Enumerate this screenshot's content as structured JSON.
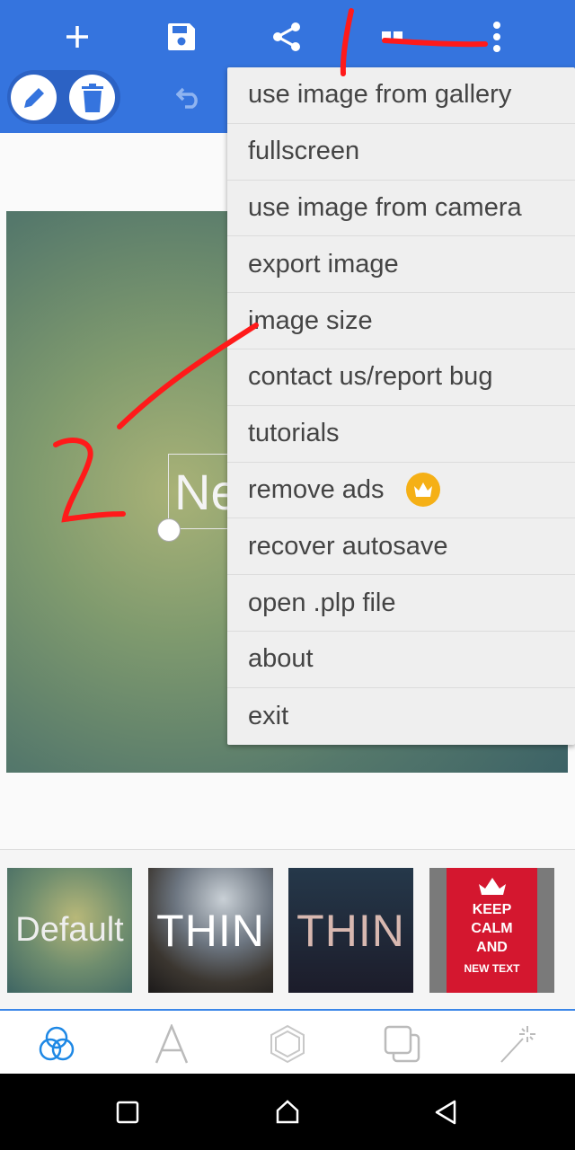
{
  "toolbar": {
    "icons": [
      "plus-icon",
      "save-icon",
      "share-icon",
      "quote-icon",
      "more-vert-icon"
    ]
  },
  "edit_mode": {
    "icons": [
      "pencil-icon",
      "trash-icon",
      "undo-icon"
    ]
  },
  "canvas": {
    "text": "New Text",
    "visible_text": "Ne"
  },
  "menu": {
    "items": [
      {
        "label": "use image from gallery"
      },
      {
        "label": "fullscreen"
      },
      {
        "label": "use image from camera"
      },
      {
        "label": "export image"
      },
      {
        "label": "image size"
      },
      {
        "label": "contact us/report bug"
      },
      {
        "label": "tutorials"
      },
      {
        "label": "remove ads",
        "badge": "crown-icon"
      },
      {
        "label": "recover autosave"
      },
      {
        "label": "open .plp file"
      },
      {
        "label": "about"
      },
      {
        "label": "exit"
      }
    ]
  },
  "templates": [
    {
      "label": "Default"
    },
    {
      "label": "THIN"
    },
    {
      "label": "THIN"
    },
    {
      "label": "KEEP CALM AND",
      "sub": "NEW TEXT"
    }
  ],
  "tabs": [
    "filters-icon",
    "text-icon",
    "shape-icon",
    "layers-icon",
    "magic-wand-icon"
  ],
  "colors": {
    "primary": "#3574de",
    "accent": "#1e88e5",
    "annotation": "#ff1a1a"
  }
}
